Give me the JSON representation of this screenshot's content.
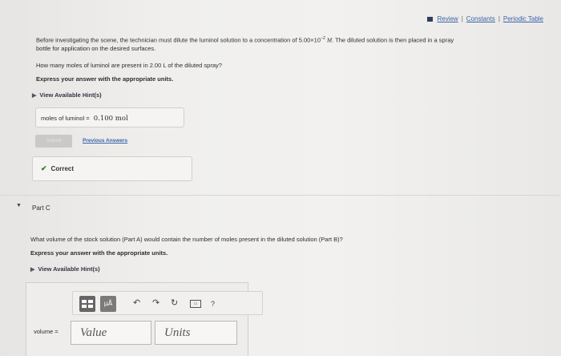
{
  "header": {
    "links": [
      "Review",
      "Constants",
      "Periodic Table"
    ],
    "separators": [
      "|",
      "|"
    ]
  },
  "partB": {
    "intro_line1": "Before investigating the scene, the technician must dilute the luminol solution to a concentration of 5.00×10",
    "intro_exp": "−2",
    "intro_unit": "M",
    "intro_line1_end": ". The diluted solution is then placed in a spray",
    "intro_line2": "bottle for application on the desired surfaces.",
    "question": "How many moles of luminol are present in 2.00 L of the diluted spray?",
    "express": "Express your answer with the appropriate units.",
    "hint": "View Available Hint(s)",
    "answer_label": "moles of luminol =",
    "answer_value": "0.100 mol",
    "submit_label": "Submit",
    "previous_answers": "Previous Answers",
    "feedback": "Correct"
  },
  "partC": {
    "title": "Part C",
    "question": "What volume of the stock solution (Part A) would contain the number of moles present in the diluted solution (Part B)?",
    "express": "Express your answer with the appropriate units.",
    "hint": "View Available Hint(s)",
    "toolbar_mu": "μÅ",
    "help_glyph": "?",
    "volume_label": "volume =",
    "value_placeholder": "Value",
    "units_placeholder": "Units"
  }
}
